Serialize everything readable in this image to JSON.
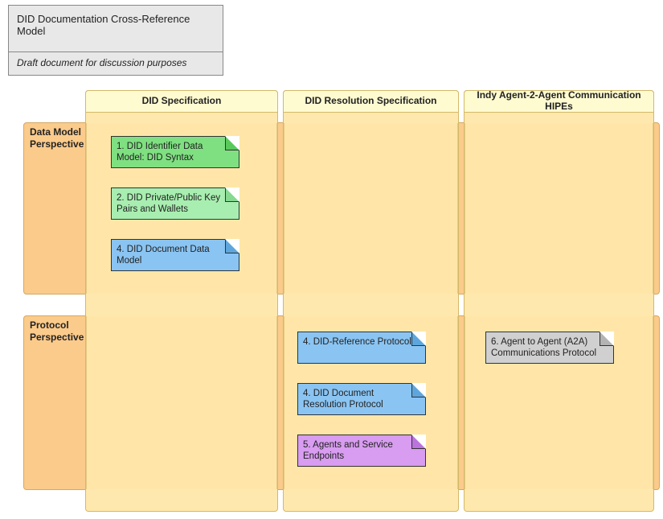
{
  "title": {
    "heading": "DID Documentation Cross-Reference Model",
    "subheading": "Draft document for discussion purposes"
  },
  "columns": {
    "c1": "DID Specification",
    "c2": "DID Resolution Specification",
    "c3": "Indy Agent-2-Agent Communication HIPEs"
  },
  "rows": {
    "r1": "Data Model Perspective",
    "r2": "Protocol Perspective"
  },
  "notes": {
    "n1": "1. DID Identifier Data Model: DID Syntax",
    "n2": "2. DID Private/Public Key Pairs and Wallets",
    "n3": "4. DID Document Data Model",
    "n4": "4. DID-Reference Protocol",
    "n5": "4. DID Document Resolution Protocol",
    "n6": "5. Agents and Service Endpoints",
    "n7": "6. Agent to Agent (A2A) Communications Protocol"
  }
}
